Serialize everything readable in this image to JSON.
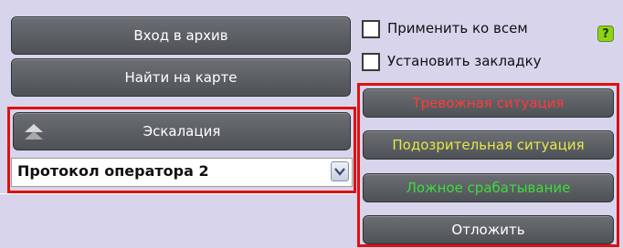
{
  "left_panel": {
    "archive_button": "Вход в архив",
    "find_on_map_button": "Найти на карте",
    "escalation_button": "Эскалация",
    "operator_protocol": {
      "selected": "Протокол оператора 2"
    }
  },
  "right_panel": {
    "apply_all_label": "Применить ко всем",
    "set_bookmark_label": "Установить закладку",
    "help_glyph": "?",
    "alarm_button": "Тревожная ситуация",
    "suspicious_button": "Подозрительная ситуация",
    "false_alarm_button": "Ложное срабатывание",
    "postpone_button": "Отложить"
  },
  "colors": {
    "alarm_text": "#ff3a3a",
    "suspicious_text": "#e6e64a",
    "false_alarm_text": "#3ddc3d",
    "highlight_frame": "#e01010"
  }
}
